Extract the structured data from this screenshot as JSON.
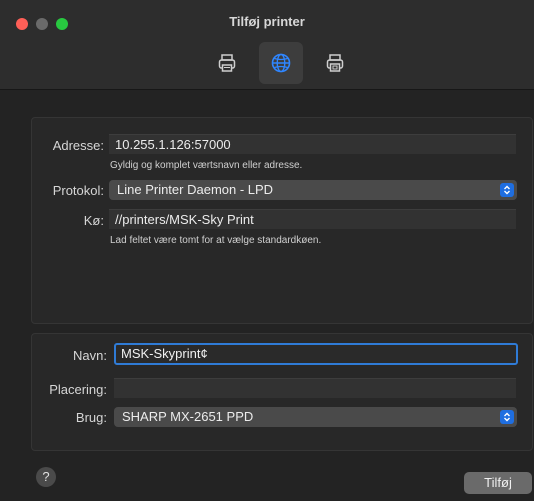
{
  "window": {
    "title": "Tilføj printer"
  },
  "toolbar": {
    "items": [
      {
        "icon": "printer-icon",
        "selected": false
      },
      {
        "icon": "globe-icon",
        "selected": true
      },
      {
        "icon": "printer-windows-icon",
        "selected": false
      }
    ]
  },
  "connection": {
    "address_label": "Adresse:",
    "address_value": "10.255.1.126:57000",
    "address_hint": "Gyldig og komplet værtsnavn eller adresse.",
    "protocol_label": "Protokol:",
    "protocol_value": "Line Printer Daemon - LPD",
    "queue_label": "Kø:",
    "queue_value": "//printers/MSK-Sky Print",
    "queue_hint": "Lad feltet være tomt for at vælge standardkøen."
  },
  "printer": {
    "name_label": "Navn:",
    "name_value": "MSK-Skyprint¢",
    "location_label": "Placering:",
    "location_value": "",
    "use_label": "Brug:",
    "use_value": "SHARP MX-2651 PPD"
  },
  "footer": {
    "help_label": "?",
    "add_label": "Tilføj"
  },
  "colors": {
    "accent": "#2f7bd6",
    "stepper": "#1f6ee0"
  }
}
